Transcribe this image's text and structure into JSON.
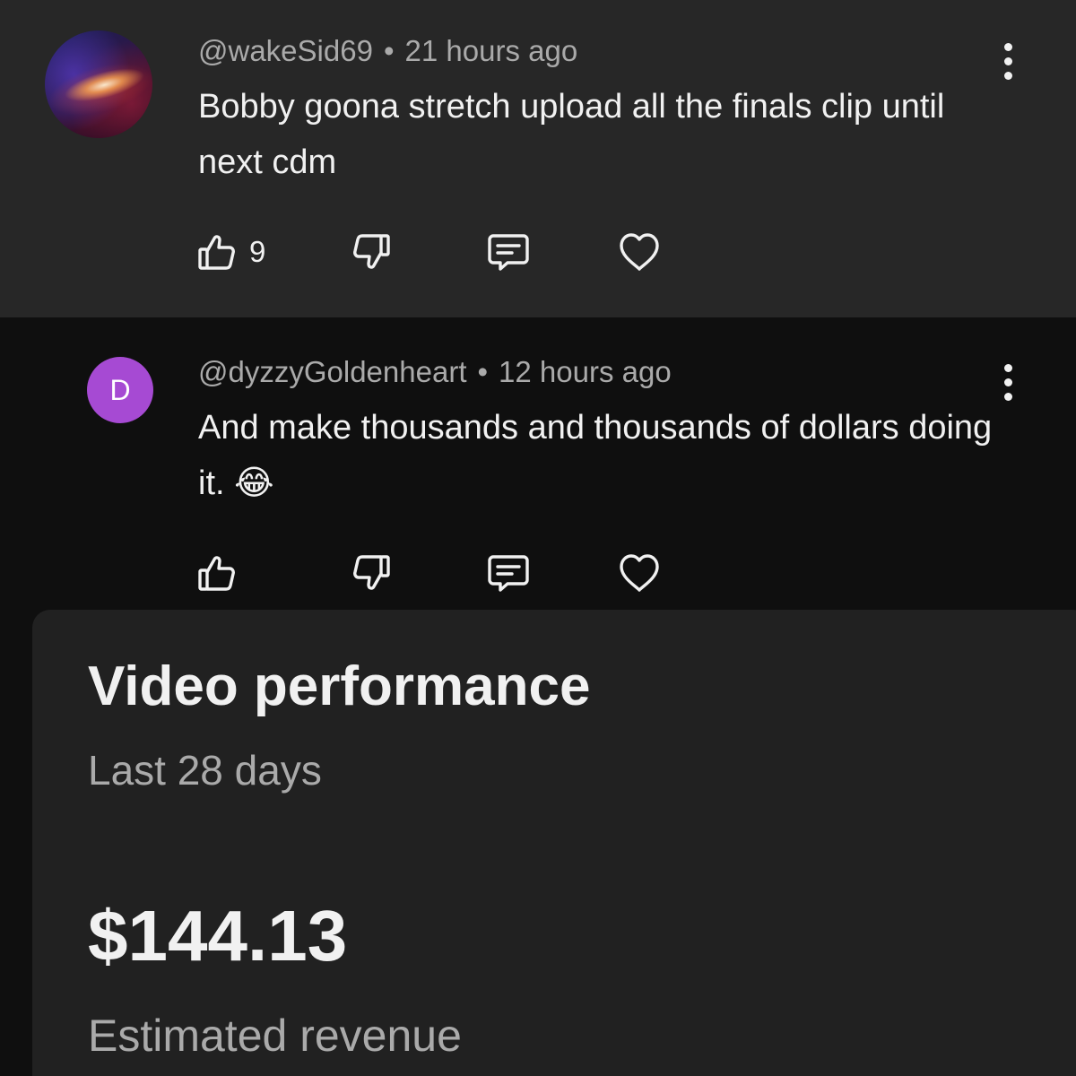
{
  "comments": [
    {
      "handle": "@wakeSid69",
      "separator": "•",
      "time": "21 hours ago",
      "text": "Bobby goona stretch upload all the finals clip until next cdm",
      "likes": "9",
      "avatar_icon": "galaxy-avatar"
    },
    {
      "handle": "@dyzzyGoldenheart",
      "separator": "•",
      "time": "12 hours ago",
      "text": "And make thousands and thousands of dollars doing it. 😂",
      "likes": "",
      "avatar_letter": "D",
      "avatar_color": "#a64ad3"
    }
  ],
  "performance": {
    "title": "Video performance",
    "period": "Last 28 days",
    "value": "$144.13",
    "label": "Estimated revenue"
  },
  "icons": {
    "like": "thumb-up-icon",
    "dislike": "thumb-down-icon",
    "reply": "reply-icon",
    "heart": "heart-icon",
    "more": "more-vertical-icon"
  },
  "colors": {
    "highlight_background": "#272727",
    "page_background": "#0f0f0f",
    "card_background": "#212121",
    "secondary_text": "#aaaaaa"
  }
}
